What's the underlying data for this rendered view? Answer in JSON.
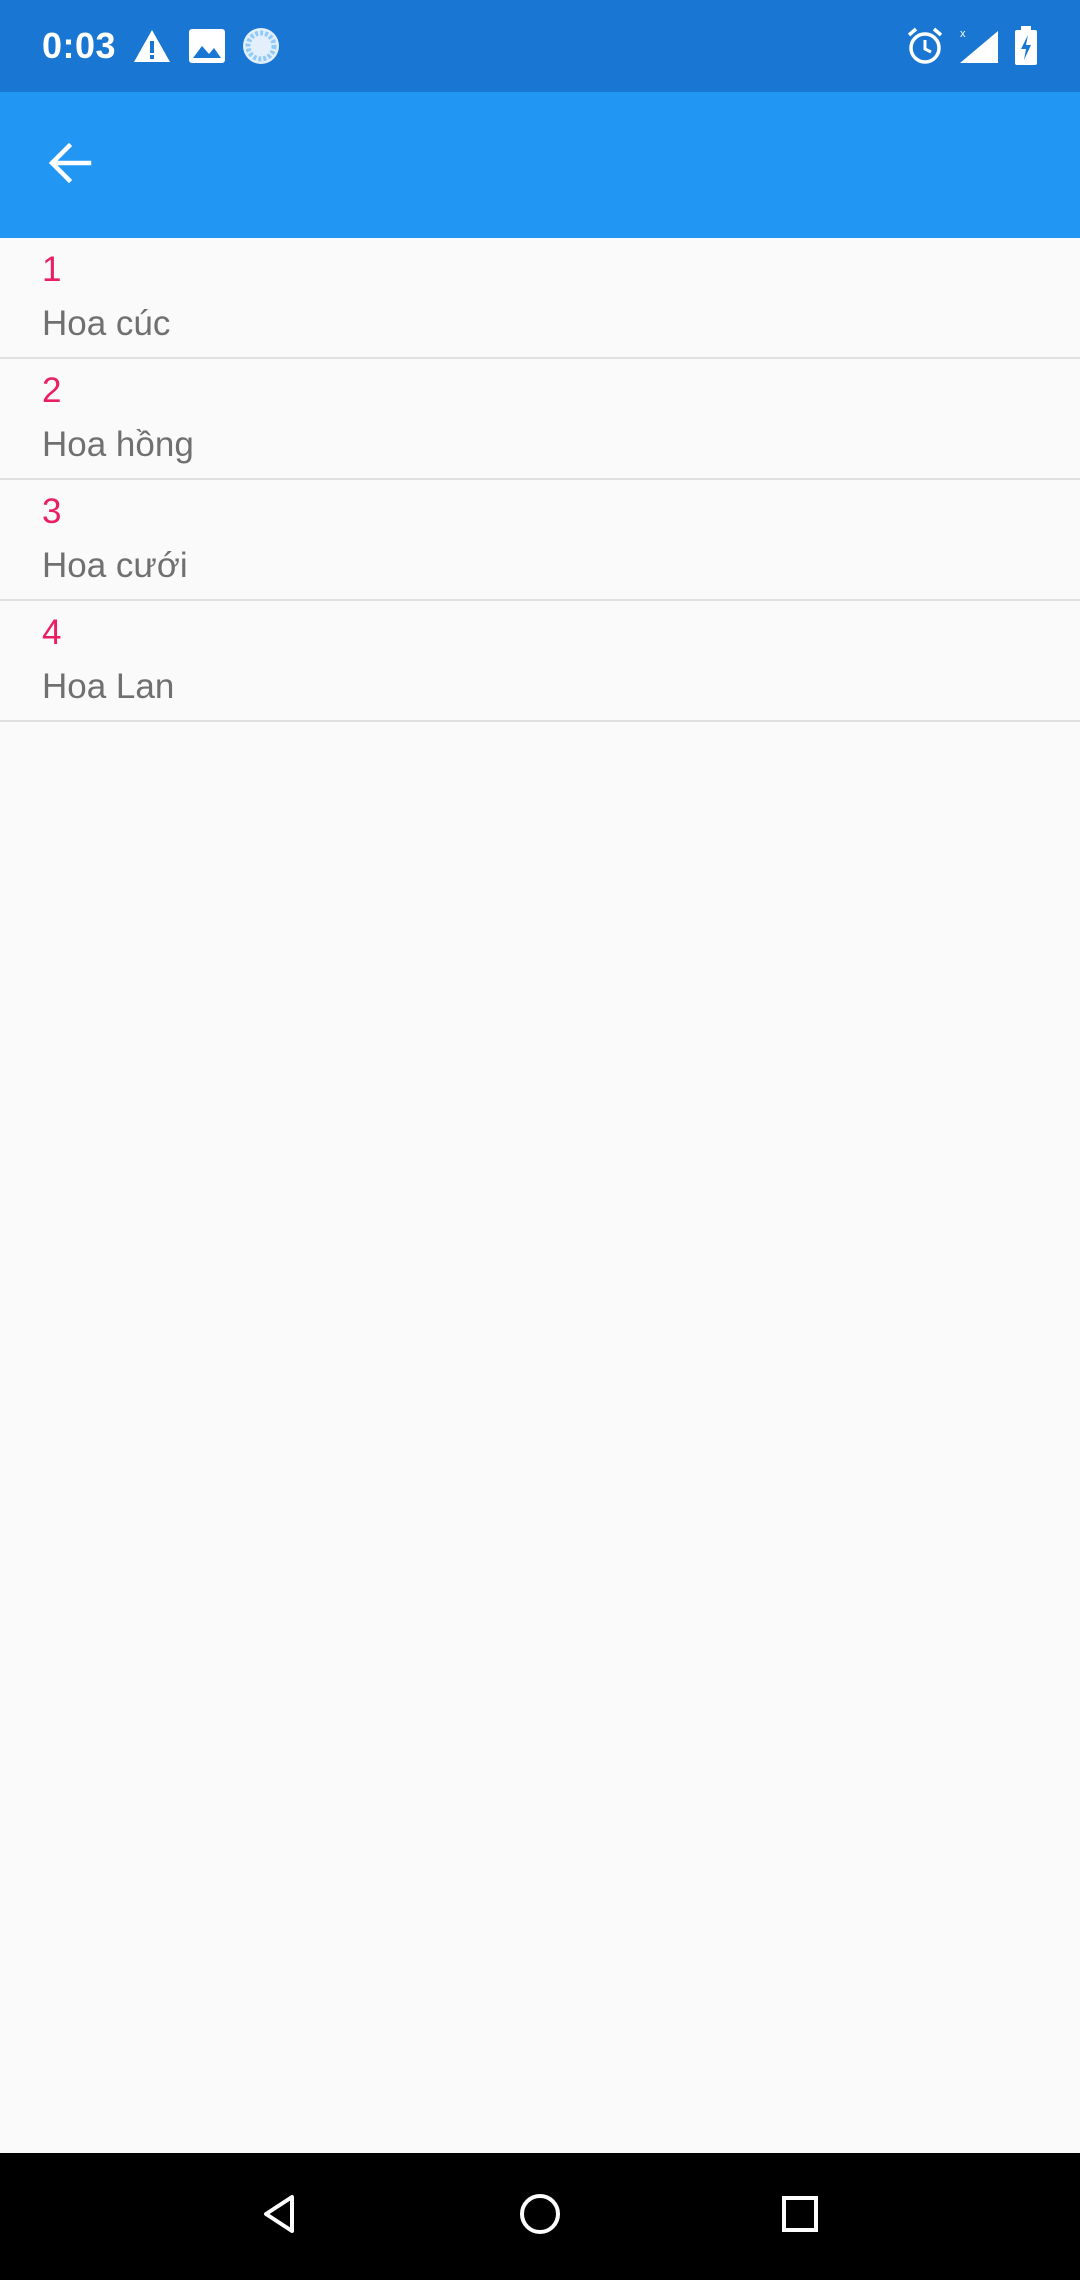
{
  "status_bar": {
    "time": "0:03",
    "icons": [
      "warning-icon",
      "image-icon",
      "sync-icon",
      "alarm-icon",
      "signal-icon",
      "battery-charging-icon"
    ]
  },
  "app_bar": {
    "back_icon": "arrow-back-icon",
    "color": "#2196f3"
  },
  "list": {
    "items": [
      {
        "number": "1",
        "name": "Hoa cúc"
      },
      {
        "number": "2",
        "name": "Hoa hồng"
      },
      {
        "number": "3",
        "name": "Hoa cưới"
      },
      {
        "number": "4",
        "name": "Hoa Lan"
      }
    ]
  },
  "nav_bar": {
    "buttons": [
      "back-triangle-icon",
      "home-circle-icon",
      "recents-square-icon"
    ]
  },
  "colors": {
    "status_bar": "#1976d2",
    "accent": "#e91e63",
    "text_secondary": "#707070",
    "background": "#fafafa"
  }
}
